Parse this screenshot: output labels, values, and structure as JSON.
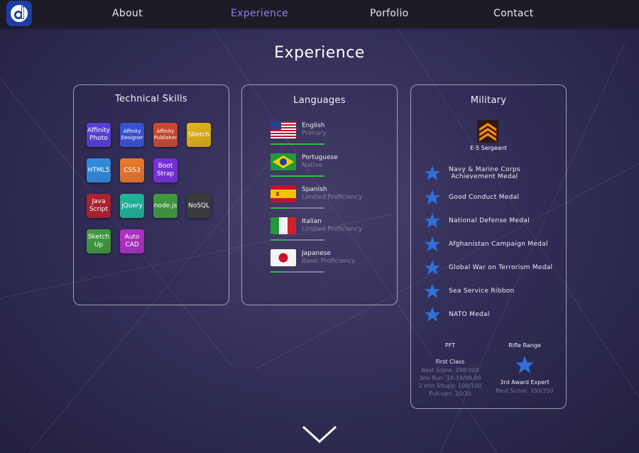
{
  "nav": {
    "logo_letter": "d",
    "items": [
      {
        "label": "About",
        "active": false
      },
      {
        "label": "Experience",
        "active": true
      },
      {
        "label": "Porfolio",
        "active": false
      },
      {
        "label": "Contact",
        "active": false
      }
    ]
  },
  "page_title": "Experience",
  "technical_skills": {
    "title": "Technical Skills",
    "items": [
      {
        "label": "Affinity\nPhoto",
        "color": "#5a3fe0"
      },
      {
        "label": "Affinity\nDesigner",
        "color": "#3a54d6"
      },
      {
        "label": "Affinity\nPublisher",
        "color": "#d24a2e"
      },
      {
        "label": "Sketch",
        "color": "#e6b512"
      },
      {
        "label": "HTML5",
        "color": "#2f8fe2"
      },
      {
        "label": "CSS3",
        "color": "#f07a2a"
      },
      {
        "label": "Boot\nStrap",
        "color": "#7a2fe0"
      },
      {
        "label": "Java\nScript",
        "color": "#b81f2a"
      },
      {
        "label": "jQuery",
        "color": "#20b89a"
      },
      {
        "label": "node.js",
        "color": "#3f9e3c"
      },
      {
        "label": "NoSQL",
        "color": "#3a3a3a"
      },
      {
        "label": "Sketch\nUp",
        "color": "#3fa03a"
      },
      {
        "label": "Auto\nCAD",
        "color": "#b32fc9"
      }
    ]
  },
  "languages": {
    "title": "Languages",
    "items": [
      {
        "name": "English",
        "level": "Primary",
        "flag": "us-flag-icon",
        "proficiency": 1.0
      },
      {
        "name": "Portuguese",
        "level": "Native",
        "flag": "brazil-flag-icon",
        "proficiency": 1.0
      },
      {
        "name": "Spanish",
        "level": "Limited Proficiency",
        "flag": "spain-flag-icon",
        "proficiency": 0.3
      },
      {
        "name": "Italian",
        "level": "Limited Proficiency",
        "flag": "italy-flag-icon",
        "proficiency": 0.3
      },
      {
        "name": "Japanese",
        "level": "Basic Proficiency",
        "flag": "japan-flag-icon",
        "proficiency": 0.25
      }
    ]
  },
  "military": {
    "title": "Military",
    "rank": "E-5 Sergeant",
    "medals": [
      "Navy & Marine Corps\nAchievement Medal",
      "Good Conduct Medal",
      "National Defense Medal",
      "Afghanistan Campaign Medal",
      "Global War on Terrorism Medal",
      "Sea Service Ribbon",
      "NATO Medal"
    ],
    "pft": {
      "heading": "PFT",
      "class": "First Class",
      "lines": [
        "Best Score: 298/300",
        "3mi Run: 18:19/98.00",
        "2 min Situps: 100/100",
        "Pull-ups: 20/20"
      ]
    },
    "rifle": {
      "heading": "Rifle Range",
      "award": "3rd Award Expert",
      "best": "Best Score: 330/350"
    }
  },
  "colors": {
    "accent": "#8f7ff0",
    "progress": "#26c431",
    "star": "#2e6fd8",
    "nav_bg": "#1d1c26"
  }
}
